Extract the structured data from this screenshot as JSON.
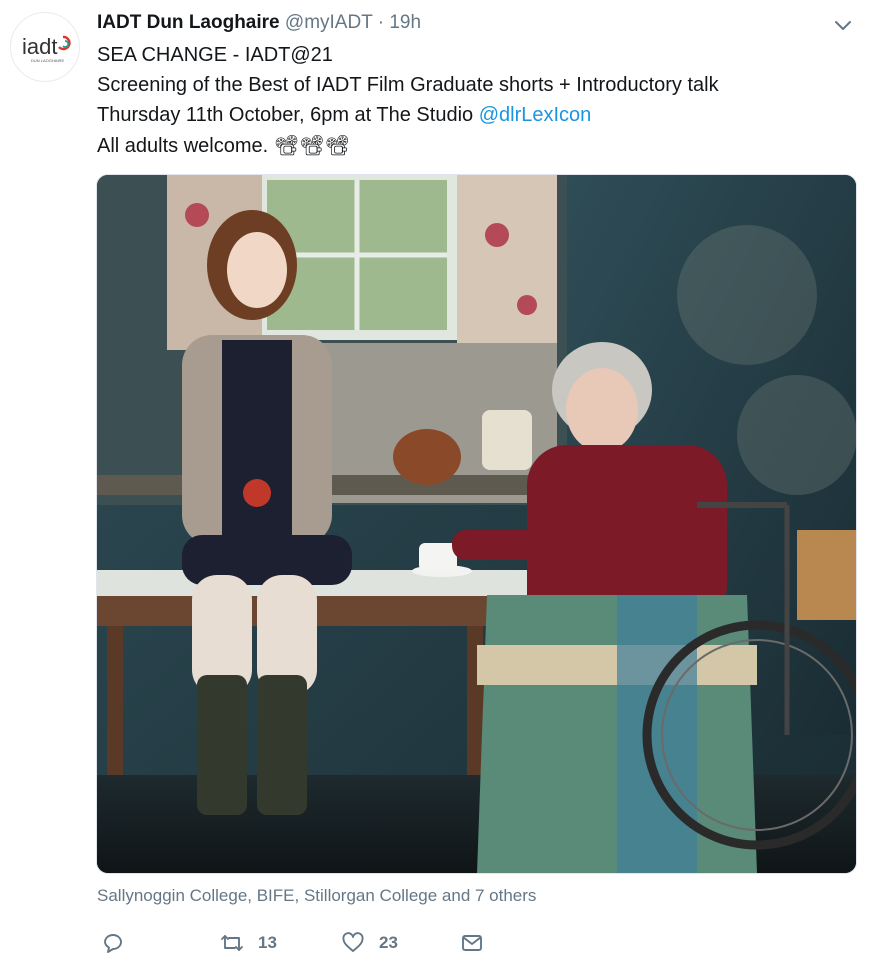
{
  "tweet": {
    "author": {
      "name": "IADT Dun Laoghaire",
      "handle": "@myIADT",
      "separator": "·",
      "time": "19h",
      "avatar_text": "iadt",
      "avatar_subtext": "DUN LAOGHAIRE"
    },
    "text": {
      "line1": "SEA CHANGE - IADT@21",
      "line2": "Screening of the Best of IADT Film Graduate shorts + Introductory talk",
      "line3_prefix": "Thursday 11th October, 6pm at The Studio ",
      "line3_mention": "@dlrLexIcon",
      "line4": "All adults welcome.",
      "line4_emoji": "📽📽📽"
    },
    "media_alt": "A young woman in a cardigan holding an apple sits on a kitchen table beside an elderly woman in a wheelchair",
    "tagged": "Sallynoggin College, BIFE, Stillorgan College and 7 others",
    "actions": {
      "reply_icon": "reply-icon",
      "retweet_icon": "retweet-icon",
      "retweet_count": "13",
      "like_icon": "heart-icon",
      "like_count": "23",
      "dm_icon": "envelope-icon"
    },
    "colors": {
      "link": "#1b95e0",
      "secondary_text": "#657786",
      "primary_text": "#14171a",
      "avatar_accent": "#e0312b"
    }
  }
}
